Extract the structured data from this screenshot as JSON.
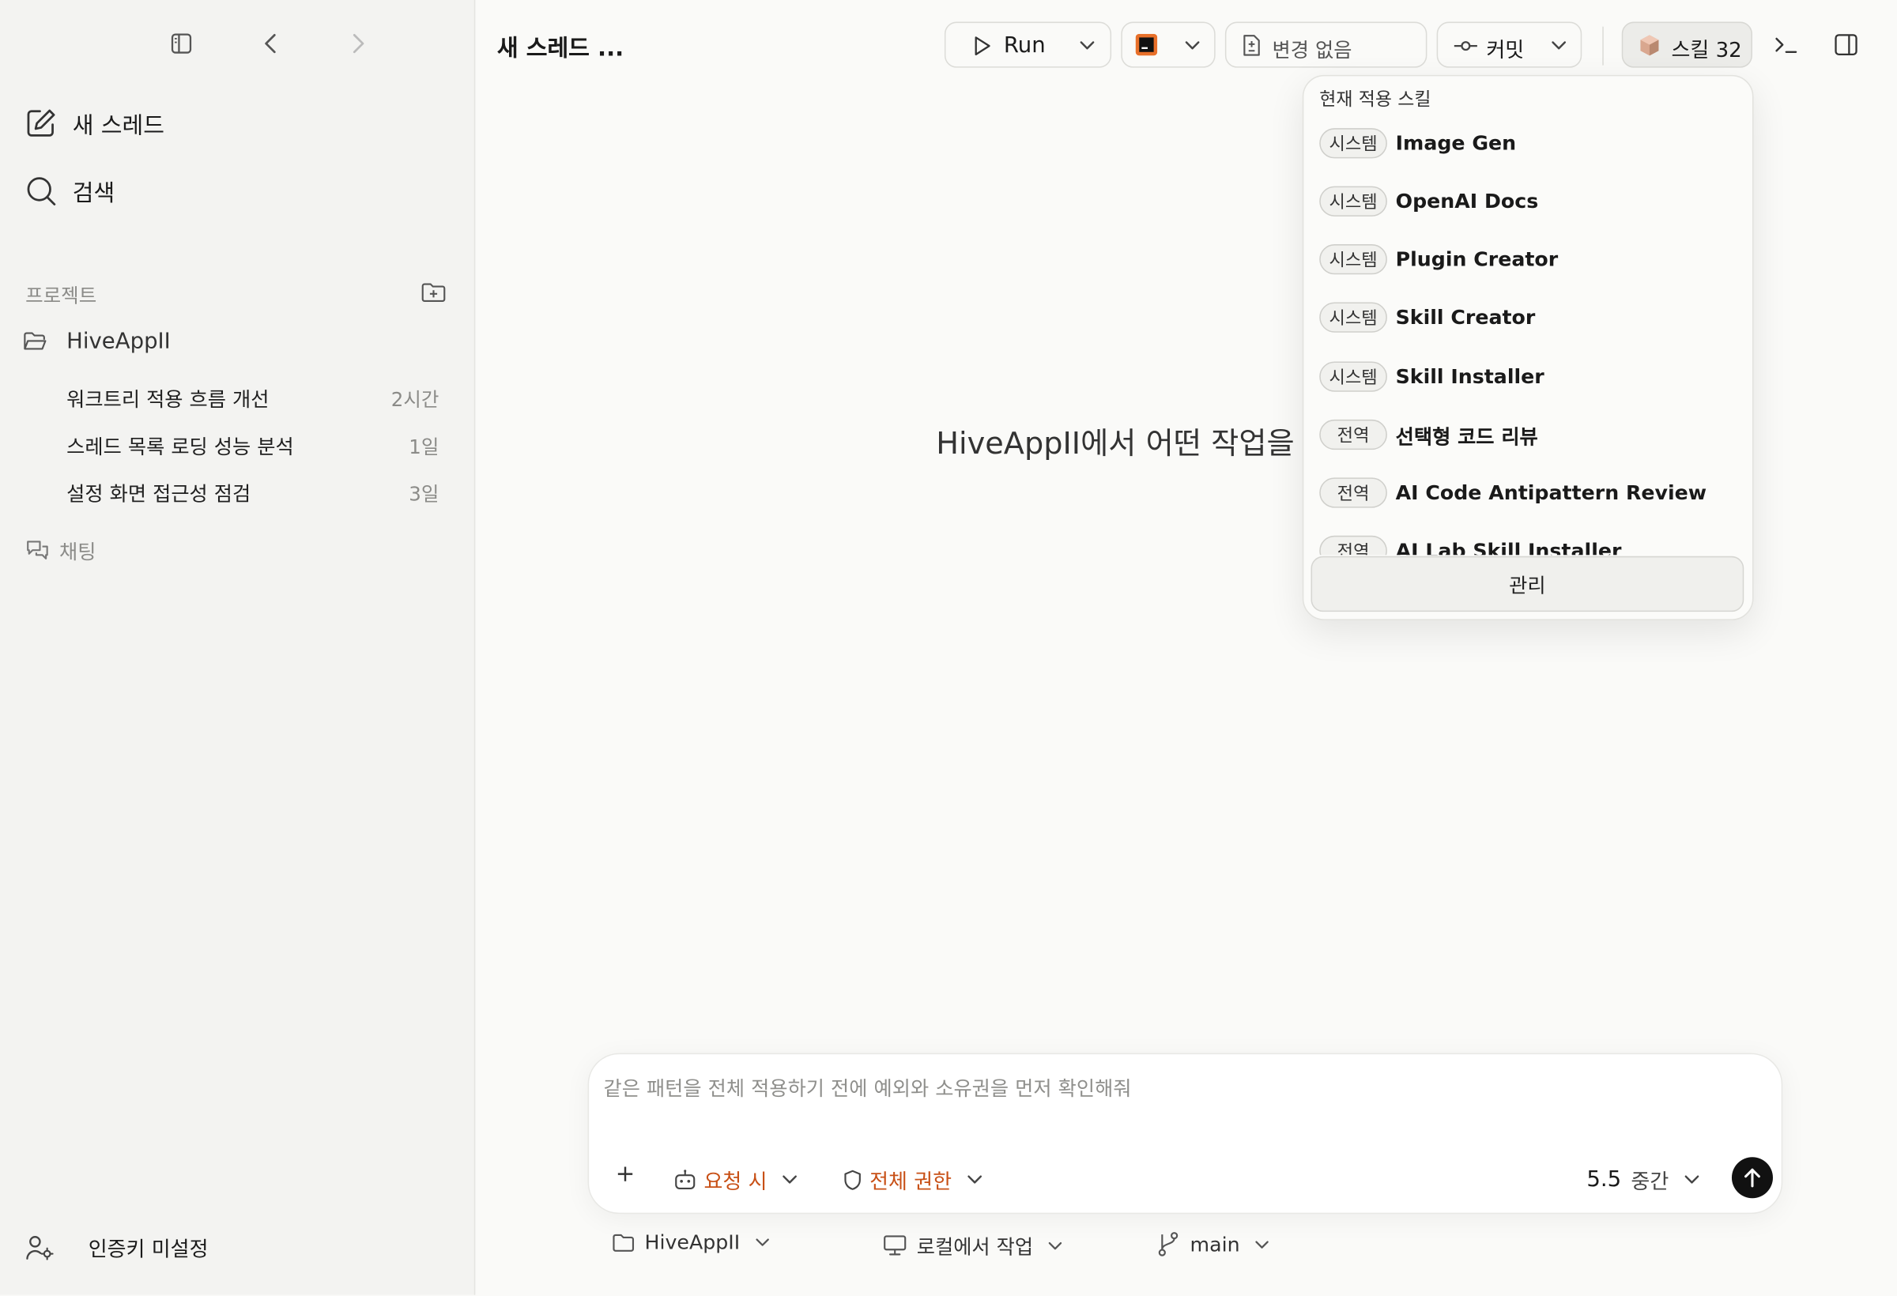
{
  "sidebar": {
    "new_thread": "새 스레드",
    "search": "검색",
    "projects_label": "프로젝트",
    "project_name": "HiveAppII",
    "threads": [
      {
        "title": "워크트리 적용 흐름 개선",
        "time": "2시간"
      },
      {
        "title": "스레드 목록 로딩 성능 분석",
        "time": "1일"
      },
      {
        "title": "설정 화면 접근성 점검",
        "time": "3일"
      }
    ],
    "chat_label": "채팅",
    "auth_status": "인증키 미설정"
  },
  "header": {
    "title": "새 스레드 ...",
    "run_label": "Run",
    "changes_label": "변경 없음",
    "commit_label": "커밋",
    "skills_label": "스킬 32"
  },
  "main": {
    "prompt_visible": "HiveAppII에서 어떤 작업을 시"
  },
  "skills_popup": {
    "heading": "현재 적용 스킬",
    "items": [
      {
        "badge": "시스템",
        "name": "Image Gen"
      },
      {
        "badge": "시스템",
        "name": "OpenAI Docs"
      },
      {
        "badge": "시스템",
        "name": "Plugin Creator"
      },
      {
        "badge": "시스템",
        "name": "Skill Creator"
      },
      {
        "badge": "시스템",
        "name": "Skill Installer"
      },
      {
        "badge": "전역",
        "name": "선택형 코드 리뷰"
      },
      {
        "badge": "전역",
        "name": "AI Code Antipattern Review"
      },
      {
        "badge": "전역",
        "name": "AI Lab Skill Installer"
      }
    ],
    "manage_label": "관리"
  },
  "composer": {
    "placeholder": "같은 패턴을 전체 적용하기 전에 예외와 소유권을 먼저 확인해줘",
    "approval_label": "요청 시",
    "permission_label": "전체 권한",
    "model_version": "5.5",
    "effort_label": "중간"
  },
  "footer": {
    "project": "HiveAppII",
    "mode": "로컬에서 작업",
    "branch": "main"
  },
  "colors": {
    "accent_orange": "#c85016",
    "background": "#fafaf8",
    "sidebar": "#f3f3f1"
  }
}
